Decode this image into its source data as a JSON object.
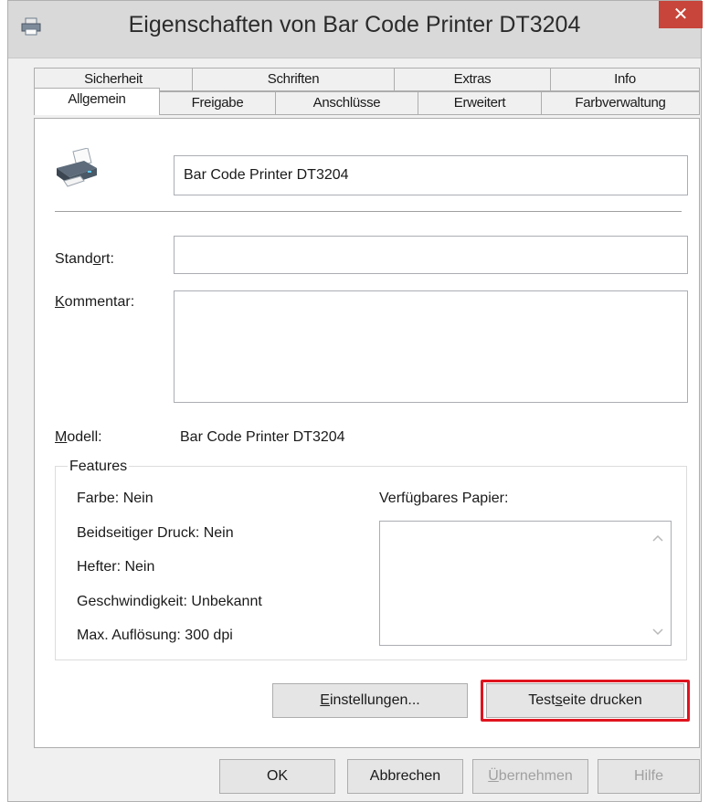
{
  "window": {
    "title": "Eigenschaften von Bar Code Printer DT3204",
    "close_glyph": "✕"
  },
  "tabs_top": [
    "Sicherheit",
    "Schriften",
    "Extras",
    "Info"
  ],
  "tabs_bottom": [
    "Allgemein",
    "Freigabe",
    "Anschlüsse",
    "Erweitert",
    "Farbverwaltung"
  ],
  "general": {
    "printer_name": "Bar Code Printer DT3204",
    "location_label_pre": "Stand",
    "location_label_key": "o",
    "location_label_post": "rt:",
    "location_value": "",
    "comment_label_key": "K",
    "comment_label_post": "ommentar:",
    "comment_value": "",
    "model_label_key": "M",
    "model_label_post": "odell:",
    "model_value": "Bar Code Printer DT3204"
  },
  "features": {
    "legend": "Features",
    "color": "Farbe: Nein",
    "duplex": "Beidseitiger Druck: Nein",
    "stapler": "Hefter: Nein",
    "speed": "Geschwindigkeit: Unbekannt",
    "resolution": "Max. Auflösung: 300 dpi",
    "paper_label": "Verfügbares Papier:"
  },
  "buttons": {
    "settings_key": "E",
    "settings_rest": "instellungen...",
    "testpage_pre": "Test",
    "testpage_key": "s",
    "testpage_post": "eite drucken",
    "ok": "OK",
    "cancel": "Abbrechen",
    "apply_key": "Ü",
    "apply_rest": "bernehmen",
    "help": "Hilfe"
  },
  "colors": {
    "highlight": "#e0141e",
    "close": "#c7453a"
  },
  "icons": {
    "app": "printer-icon",
    "printer": "printer-icon",
    "scroll_up": "chevron-up-icon",
    "scroll_down": "chevron-down-icon"
  }
}
